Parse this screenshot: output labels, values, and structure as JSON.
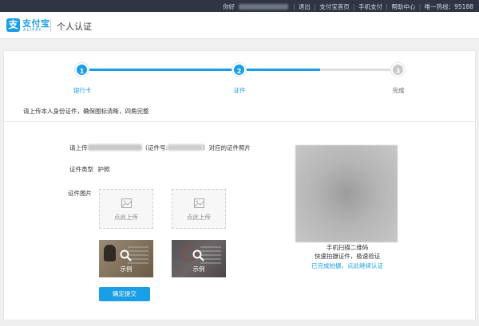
{
  "topbar": {
    "greeting": "你好",
    "logout": "退出",
    "alipay_home": "支付宝首页",
    "mobile_pay": "手机支付",
    "help_center": "帮助中心",
    "hotline": "唯一热线：95188"
  },
  "header": {
    "logo_cn": "支付宝",
    "logo_en": "ALIPAY",
    "page_title": "个人认证"
  },
  "steps": [
    {
      "number": "1",
      "label": "银行卡",
      "state": "done"
    },
    {
      "number": "2",
      "label": "证件",
      "state": "active"
    },
    {
      "number": "3",
      "label": "完成",
      "state": "pending"
    }
  ],
  "instruction": "请上传本人身份证件，确保图标清晰，四角完整",
  "form": {
    "upload_prefix": "请上传",
    "id_prefix": "（证件号:",
    "upload_suffix": "）对应的证件照片",
    "id_type_label": "证件类型",
    "id_type_value": "护照",
    "image_label": "证件图片",
    "upload_front_text": "点此上传",
    "upload_back_text": "点此上传",
    "example_front_text": "示例",
    "example_back_text": "示例",
    "submit_label": "确定提交"
  },
  "qr": {
    "line1": "手机扫描二维码",
    "line2": "快速拍摄证件，极速验证",
    "link": "已完成拍摄，点此继续认证"
  },
  "colors": {
    "accent": "#1a9ee6",
    "topbar_bg": "#2f3542",
    "step_inactive": "#c8c8c8"
  }
}
